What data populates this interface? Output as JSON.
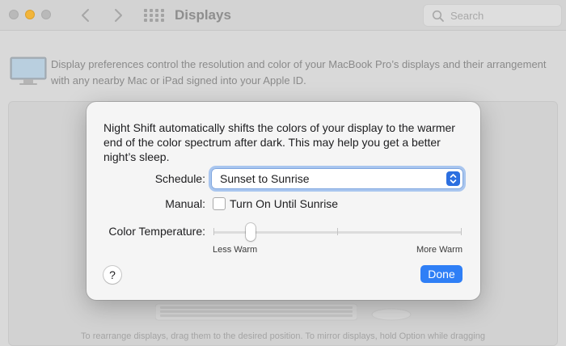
{
  "window": {
    "title": "Displays",
    "search_placeholder": "Search"
  },
  "intro_text": "Display preferences control the resolution and color of your MacBook Pro’s displays and their arrangement with any nearby Mac or iPad signed into your Apple ID.",
  "arrange_hint": "To rearrange displays, drag them to the desired position. To mirror displays, hold Option while dragging",
  "night_shift": {
    "description": "Night Shift automatically shifts the colors of your display to the warmer end of the color spectrum after dark. This may help you get a better night’s sleep.",
    "schedule_label": "Schedule:",
    "schedule_value": "Sunset to Sunrise",
    "manual_label": "Manual:",
    "manual_checkbox_label": "Turn On Until Sunrise",
    "manual_checked": false,
    "color_temp_label": "Color Temperature:",
    "slider_min_label": "Less Warm",
    "slider_max_label": "More Warm",
    "slider_value": 0.15,
    "help_label": "?",
    "done_label": "Done"
  },
  "colors": {
    "accent": "#2f7ff6",
    "traffic_yellow": "#f2b53a"
  }
}
